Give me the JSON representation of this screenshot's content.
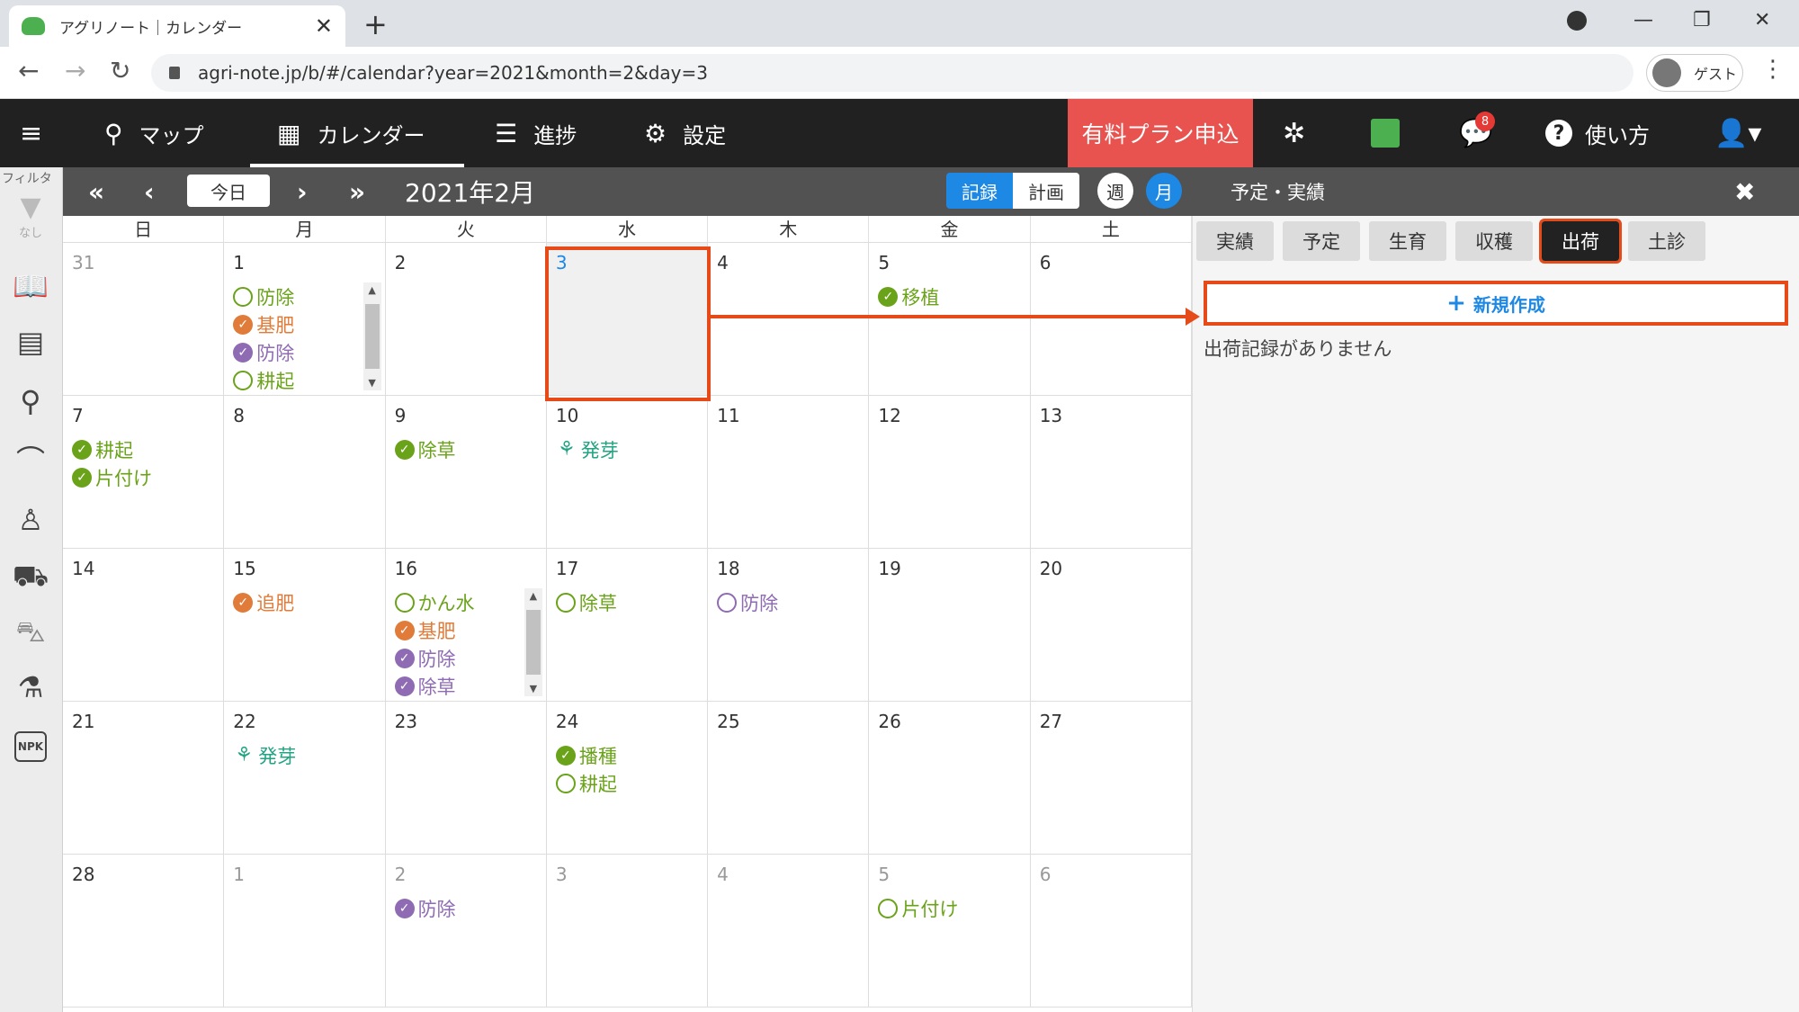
{
  "browser": {
    "tab_title": "アグリノート｜カレンダー",
    "tab_close": "✕",
    "new_tab": "+",
    "url": "agri-note.jp/b/#/calendar?year=2021&month=2&day=3",
    "profile_label": "ゲスト"
  },
  "header": {
    "nav": [
      {
        "label": "マップ",
        "icon": "map-pin-icon"
      },
      {
        "label": "カレンダー",
        "icon": "calendar-icon"
      },
      {
        "label": "進捗",
        "icon": "checklist-icon"
      },
      {
        "label": "設定",
        "icon": "gear-icon"
      }
    ],
    "active_nav": "カレンダー",
    "paid_plan": "有料プラン申込",
    "notification_count": "8",
    "help": "使い方",
    "accent": "#e9534f"
  },
  "sidebar": {
    "filter_label": "フィルタ",
    "filter_none": "なし",
    "icons": [
      "book-icon",
      "document-icon",
      "map-pin-icon",
      "sickle-icon",
      "worker-icon",
      "tractor-icon",
      "wheelbarrow-icon",
      "flask-icon",
      "fertilizer-npk-icon"
    ],
    "npk_label": "NPK"
  },
  "toolbar": {
    "today": "今日",
    "month_title": "2021年2月",
    "record": "記録",
    "plan": "計画",
    "week": "週",
    "month": "月",
    "panel_title": "予定・実績"
  },
  "calendar": {
    "weekdays": [
      "日",
      "月",
      "火",
      "水",
      "木",
      "金",
      "土"
    ],
    "colors": {
      "green": "#6aa31a",
      "orange": "#e07b39",
      "purple": "#8e6bb3",
      "teal": "#22a383",
      "selected_day": "#1e88e5"
    },
    "weeks": [
      [
        {
          "day": "31",
          "other": true,
          "events": []
        },
        {
          "day": "1",
          "scroll": true,
          "events": [
            {
              "label": "防除",
              "color": "green",
              "done": false
            },
            {
              "label": "基肥",
              "color": "orange",
              "done": true
            },
            {
              "label": "防除",
              "color": "purple",
              "done": true
            },
            {
              "label": "耕起",
              "color": "green",
              "done": false
            }
          ]
        },
        {
          "day": "2",
          "events": []
        },
        {
          "day": "3",
          "selected": true,
          "events": []
        },
        {
          "day": "4",
          "events": []
        },
        {
          "day": "5",
          "events": [
            {
              "label": "移植",
              "color": "green",
              "done": true
            }
          ]
        },
        {
          "day": "6",
          "events": []
        }
      ],
      [
        {
          "day": "7",
          "events": [
            {
              "label": "耕起",
              "color": "green",
              "done": true
            },
            {
              "label": "片付け",
              "color": "green",
              "done": true
            }
          ]
        },
        {
          "day": "8",
          "events": []
        },
        {
          "day": "9",
          "events": [
            {
              "label": "除草",
              "color": "green",
              "done": true
            }
          ]
        },
        {
          "day": "10",
          "events": [
            {
              "label": "発芽",
              "color": "teal",
              "sprout": true
            }
          ]
        },
        {
          "day": "11",
          "events": []
        },
        {
          "day": "12",
          "events": []
        },
        {
          "day": "13",
          "events": []
        }
      ],
      [
        {
          "day": "14",
          "events": []
        },
        {
          "day": "15",
          "events": [
            {
              "label": "追肥",
              "color": "orange",
              "done": true
            }
          ]
        },
        {
          "day": "16",
          "scroll": true,
          "events": [
            {
              "label": "かん水",
              "color": "green",
              "done": false
            },
            {
              "label": "基肥",
              "color": "orange",
              "done": true
            },
            {
              "label": "防除",
              "color": "purple",
              "done": true
            },
            {
              "label": "除草",
              "color": "purple",
              "done": true
            }
          ]
        },
        {
          "day": "17",
          "events": [
            {
              "label": "除草",
              "color": "green",
              "done": false
            }
          ]
        },
        {
          "day": "18",
          "events": [
            {
              "label": "防除",
              "color": "purple",
              "done": false
            }
          ]
        },
        {
          "day": "19",
          "events": []
        },
        {
          "day": "20",
          "events": []
        }
      ],
      [
        {
          "day": "21",
          "events": []
        },
        {
          "day": "22",
          "events": [
            {
              "label": "発芽",
              "color": "teal",
              "sprout": true
            }
          ]
        },
        {
          "day": "23",
          "events": []
        },
        {
          "day": "24",
          "events": [
            {
              "label": "播種",
              "color": "green",
              "done": true
            },
            {
              "label": "耕起",
              "color": "green",
              "done": false
            }
          ]
        },
        {
          "day": "25",
          "events": []
        },
        {
          "day": "26",
          "events": []
        },
        {
          "day": "27",
          "events": []
        }
      ],
      [
        {
          "day": "28",
          "events": []
        },
        {
          "day": "1",
          "other": true,
          "events": []
        },
        {
          "day": "2",
          "other": true,
          "events": [
            {
              "label": "防除",
              "color": "purple",
              "done": true
            }
          ]
        },
        {
          "day": "3",
          "other": true,
          "events": []
        },
        {
          "day": "4",
          "other": true,
          "events": []
        },
        {
          "day": "5",
          "other": true,
          "events": [
            {
              "label": "片付け",
              "color": "green",
              "done": false
            }
          ]
        },
        {
          "day": "6",
          "other": true,
          "events": []
        }
      ]
    ]
  },
  "panel": {
    "tabs": [
      "実績",
      "予定",
      "生育",
      "収穫",
      "出荷",
      "土診"
    ],
    "active_tab": "出荷",
    "new_button": "新規作成",
    "empty_message": "出荷記録がありません",
    "highlight_color": "#e64a19"
  }
}
